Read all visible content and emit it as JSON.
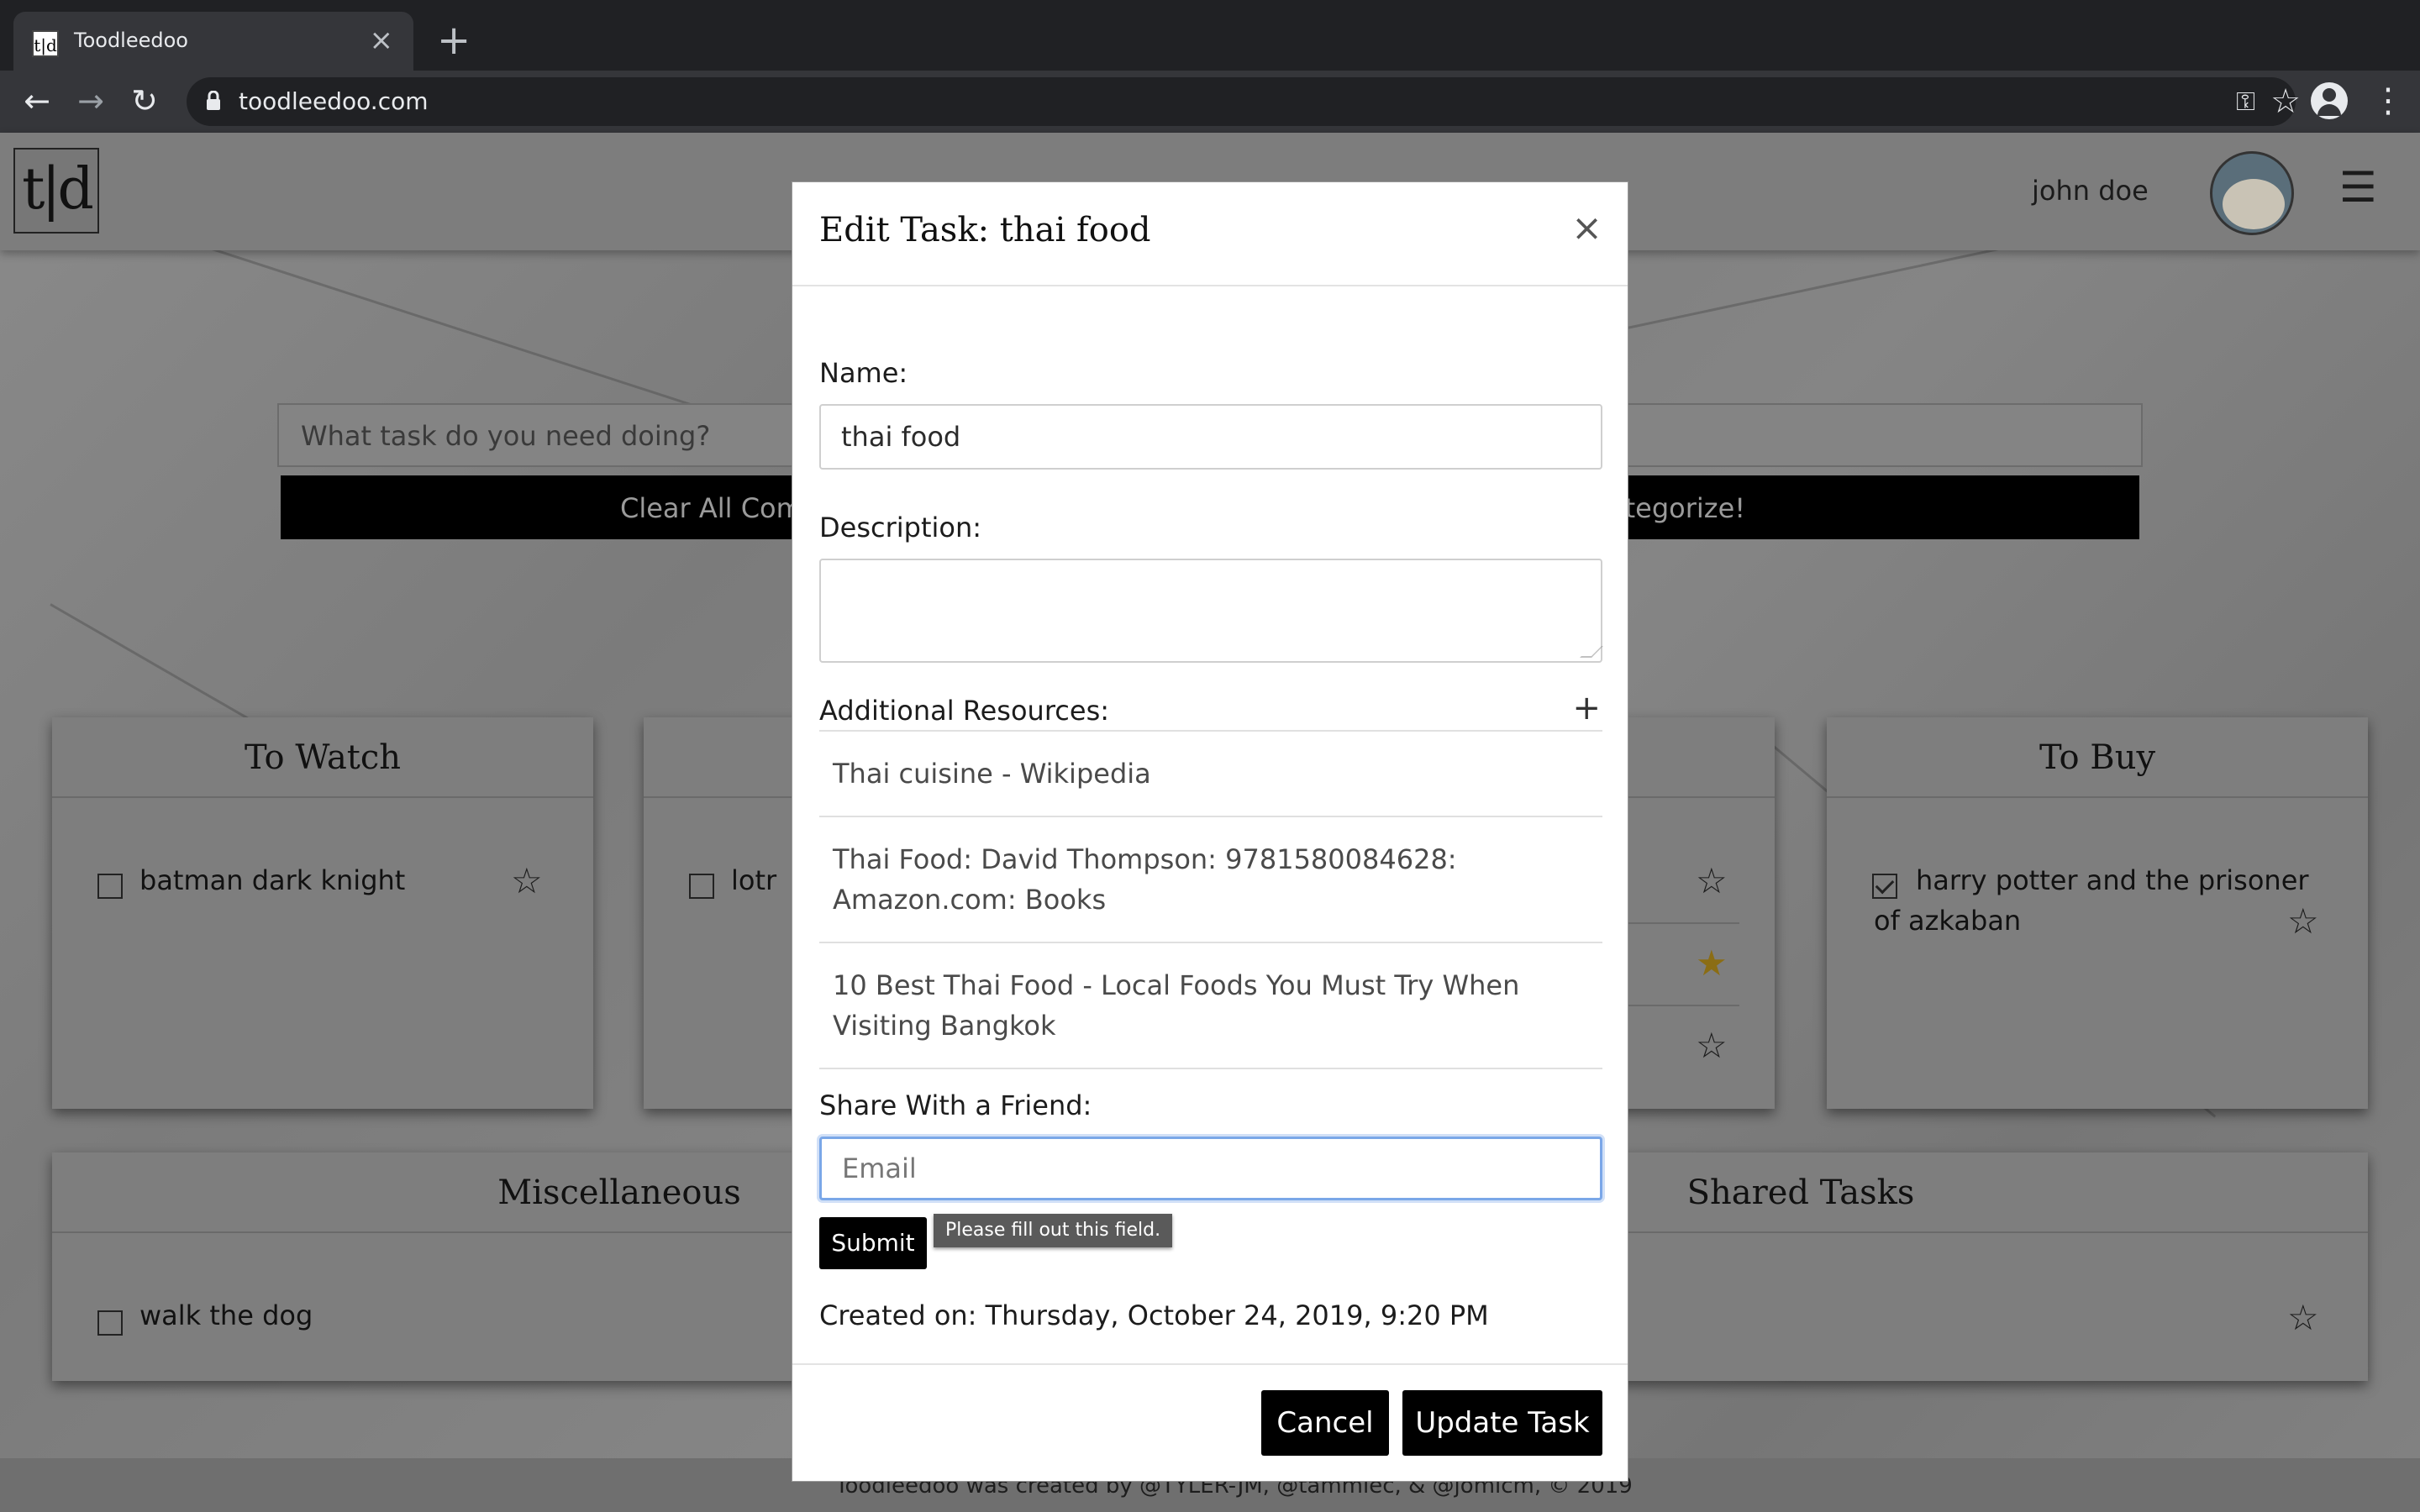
{
  "browser": {
    "tab_title": "Toodleedoo",
    "favicon_text": "t|d",
    "url": "toodleedoo.com",
    "icons": [
      "back-icon",
      "forward-icon",
      "reload-icon",
      "lock-icon",
      "key-icon",
      "bookmark-star-icon",
      "profile-icon",
      "menu-kebab-icon"
    ]
  },
  "app": {
    "logo": "t|d",
    "username": "john doe",
    "task_placeholder": "What task do you need doing?",
    "clear_label": "Clear All Com",
    "categorize_label": "ategorize!",
    "footer": "Toodleedoo was created by @TYLER-JM, @tammiec, & @jomicm, © 2019"
  },
  "lists": {
    "to_watch": {
      "title": "To Watch",
      "items": [
        {
          "label": "batman dark knight",
          "checked": false,
          "starred": false
        }
      ]
    },
    "second": {
      "items": [
        {
          "label": "lotr",
          "checked": false
        }
      ]
    },
    "third": {
      "stars": [
        "empty",
        "filled",
        "empty"
      ]
    },
    "to_buy": {
      "title": "To Buy",
      "items": [
        {
          "label": "harry potter and the prisoner of azkaban",
          "checked": true,
          "starred": false
        }
      ]
    },
    "misc": {
      "title": "Miscellaneous",
      "items": [
        {
          "label": "walk the dog",
          "checked": false
        }
      ]
    },
    "shared": {
      "title": "Shared Tasks"
    }
  },
  "modal": {
    "title": "Edit Task: thai food",
    "close": "×",
    "name_label": "Name:",
    "name_value": "thai food",
    "description_label": "Description:",
    "description_value": "",
    "resources_label": "Additional Resources:",
    "add_symbol": "+",
    "resources": [
      "Thai cuisine - Wikipedia",
      "Thai Food: David Thompson: 9781580084628: Amazon.com: Books",
      "10 Best Thai Food - Local Foods You Must Try When Visiting Bangkok"
    ],
    "share_label": "Share With a Friend:",
    "email_placeholder": "Email",
    "submit_label": "Submit",
    "validation_tooltip": "Please fill out this field.",
    "created": "Created on: Thursday, October 24, 2019, 9:20 PM",
    "cancel_label": "Cancel",
    "update_label": "Update Task"
  },
  "colors": {
    "accent_focus": "#7aa7e8",
    "button_bg": "#000000",
    "star_filled": "#c9a227"
  }
}
